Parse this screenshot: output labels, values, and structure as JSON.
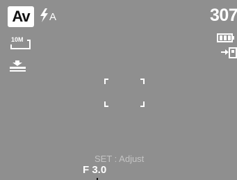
{
  "mode": {
    "label": "Av",
    "name": "aperture-priority"
  },
  "flash": {
    "label": "A",
    "icon": "flash-auto-icon"
  },
  "shots_remaining": "307",
  "resolution": {
    "label": "10M",
    "icon": "image-size-icon"
  },
  "stabilizer": {
    "icon": "image-stabilization-icon"
  },
  "battery": {
    "icon": "battery-icon",
    "level": 1.0
  },
  "storage": {
    "icon": "internal-memory-icon"
  },
  "focus_frame": {
    "icon": "focus-frame-icon"
  },
  "hint": "SET : Adjust",
  "aperture": "F 3.0",
  "colors": {
    "background": "#8f8f8f",
    "foreground": "#ffffff",
    "hint": "#c4c4c4"
  }
}
